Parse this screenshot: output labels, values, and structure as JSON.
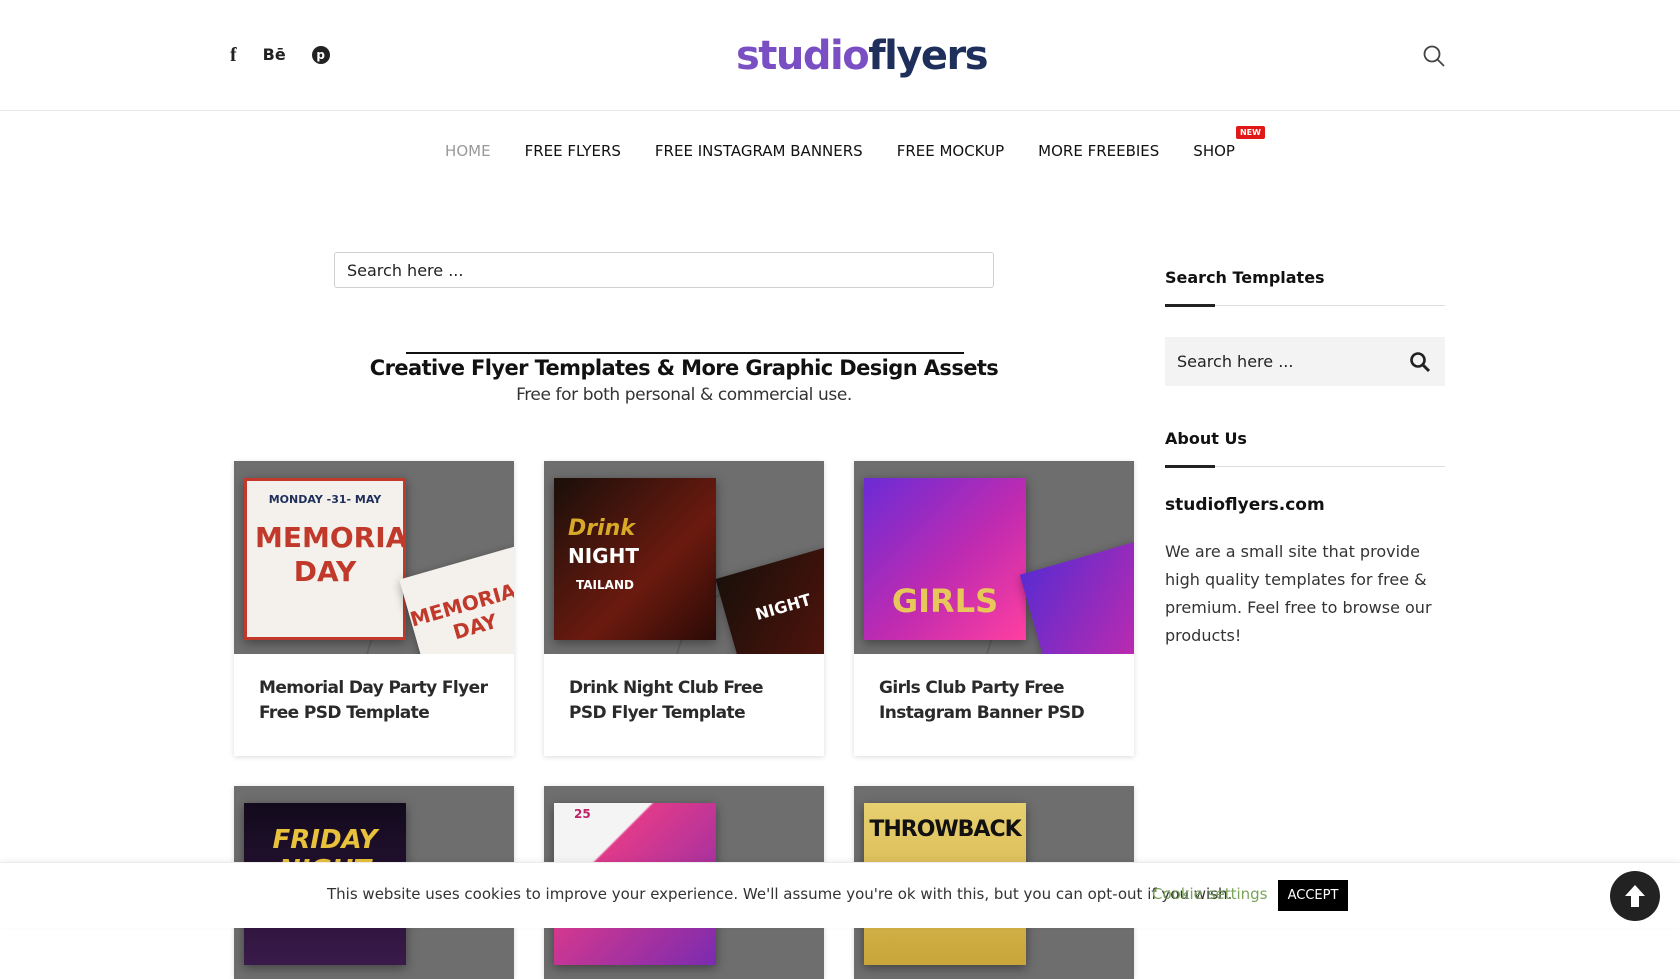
{
  "header": {
    "logo": {
      "part1": "studio",
      "part2": "flyers"
    },
    "social": [
      {
        "icon": "facebook-icon",
        "glyph": "f"
      },
      {
        "icon": "behance-icon",
        "glyph": "Bē"
      },
      {
        "icon": "pinterest-icon",
        "glyph": "p"
      }
    ],
    "search_icon": "search-icon"
  },
  "nav": {
    "items": [
      {
        "label": "HOME",
        "active": true
      },
      {
        "label": "FREE FLYERS"
      },
      {
        "label": "FREE INSTAGRAM BANNERS"
      },
      {
        "label": "FREE MOCKUP"
      },
      {
        "label": "MORE FREEBIES"
      },
      {
        "label": "SHOP",
        "badge": "NEW"
      }
    ]
  },
  "main": {
    "search_placeholder": "Search here ...",
    "hero_title": "Creative Flyer Templates & More Graphic Design Assets",
    "hero_subtitle": "Free for both personal & commercial use.",
    "cards": [
      {
        "title": "Memorial Day Party Flyer Free PSD Template",
        "poster": {
          "top": "MONDAY -31- MAY",
          "main": "MEMORIAL DAY"
        }
      },
      {
        "title": "Drink Night Club Free PSD Flyer Template",
        "poster": {
          "top": "Drink",
          "main": "NIGHT",
          "sub": "TAILAND"
        }
      },
      {
        "title": "Girls Club Party Free Instagram Banner PSD",
        "poster": {
          "main": "GIRLS"
        }
      },
      {
        "title": "",
        "poster": {
          "main": "FRIDAY NIGHT"
        }
      },
      {
        "title": "",
        "poster": {
          "main": "25"
        }
      },
      {
        "title": "",
        "poster": {
          "main": "THROWBACK"
        }
      }
    ]
  },
  "sidebar": {
    "search_heading": "Search Templates",
    "search_placeholder": "Search here ...",
    "about_heading": "About Us",
    "about_site": "studioflyers.com",
    "about_text": "We are a small site that provide high quality templates for free & premium. Feel free to browse our products!"
  },
  "cookie": {
    "text": "This website uses cookies to improve your experience. We'll assume you're ok with this, but you can opt-out if you wish.",
    "settings_label": "Cookie settings",
    "accept_label": "ACCEPT"
  },
  "colors": {
    "logo_purple": "#7a4fc4",
    "logo_navy": "#1e2f5c",
    "badge_red": "#e01818",
    "cookie_link_green": "#7aa35a"
  }
}
